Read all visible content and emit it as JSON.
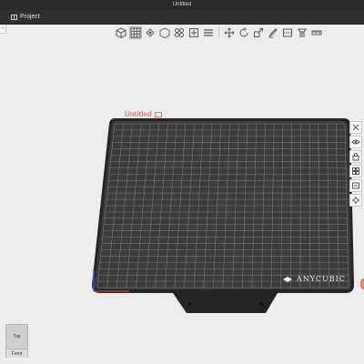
{
  "window": {
    "title": "Untitled"
  },
  "menu": {
    "project_label": "Project"
  },
  "bed": {
    "name": "Untitled",
    "brand": "ANYCUBIC",
    "grid_color": "#8a8a8a",
    "plate_color": "#3c3c3c",
    "frame_color": "#242424"
  },
  "accent_color": "#e08060",
  "view_cube": {
    "top_label": "Top",
    "front_label": "Front"
  },
  "toolbar_icons": [
    "cube-view-icon",
    "grid-view-icon",
    "cloud-icon",
    "cube-outline-icon",
    "arrange-icon",
    "orient-icon",
    "layers-icon",
    "move-icon",
    "rotate-icon",
    "scale-icon",
    "paint-icon",
    "cut-icon",
    "support-icon",
    "measure-icon"
  ],
  "right_toolbar_icons": [
    "close-plate-icon",
    "eye-icon",
    "lock-icon",
    "arrange-plate-icon",
    "orient-plate-icon",
    "settings-plate-icon"
  ]
}
